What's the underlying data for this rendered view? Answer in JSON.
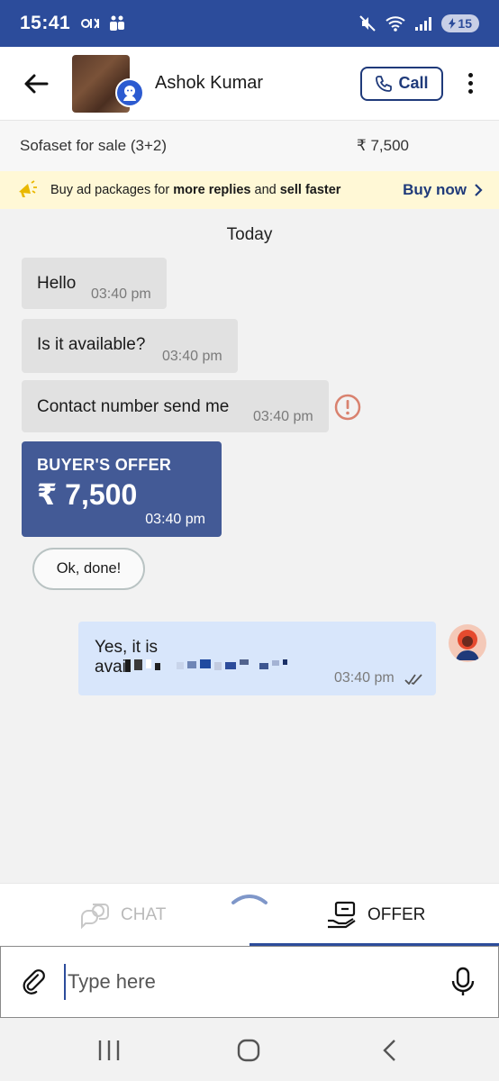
{
  "status_bar": {
    "time": "15:41",
    "battery": "15"
  },
  "header": {
    "contact_name": "Ashok Kumar",
    "call_label": "Call"
  },
  "listing": {
    "title": "Sofaset for sale (3+2)",
    "price": "₹ 7,500"
  },
  "promo": {
    "text_prefix": "Buy ad packages for ",
    "text_bold1": "more replies",
    "text_mid": " and ",
    "text_bold2": "sell faster",
    "action": "Buy now"
  },
  "chat": {
    "day_label": "Today",
    "messages": [
      {
        "text": "Hello",
        "time": "03:40 pm"
      },
      {
        "text": "Is it available?",
        "time": "03:40 pm"
      },
      {
        "text": "Contact number send me",
        "time": "03:40 pm"
      }
    ],
    "offer": {
      "label": "BUYER'S OFFER",
      "amount": "₹ 7,500",
      "time": "03:40 pm"
    },
    "quick_reply": "Ok, done!",
    "outgoing": {
      "line1": "Yes, it is",
      "line2": "avai",
      "time": "03:40 pm"
    }
  },
  "tabs": {
    "chat": "CHAT",
    "offer": "OFFER"
  },
  "input": {
    "placeholder": "Type here"
  },
  "colors": {
    "brand": "#2c4c9b",
    "offer_card": "#435a96",
    "outgoing_bubble": "#d8e6fb",
    "incoming_bubble": "#e1e1e1",
    "promo_bg": "#fff8d6"
  }
}
